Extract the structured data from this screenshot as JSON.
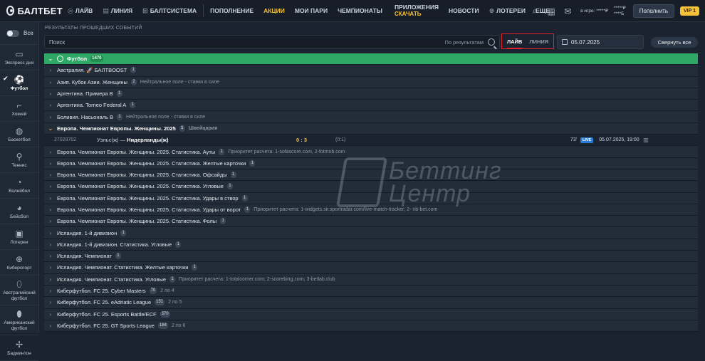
{
  "header": {
    "logo": "БАЛТБЕТ",
    "nav": [
      {
        "label": "ЛАЙВ",
        "icon": "live-icon"
      },
      {
        "label": "ЛИНИЯ",
        "icon": "line-icon"
      },
      {
        "label": "БАЛТСИСТЕМА",
        "icon": "system-icon"
      }
    ],
    "nav2": [
      "ПОПОЛНЕНИЕ",
      "АКЦИИ",
      "МОИ ПАРИ",
      "ЧЕМПИОНАТЫ"
    ],
    "apps": {
      "label": "ПРИЛОЖЕНИЯ",
      "sub": "СКАЧАТЬ"
    },
    "nav3": [
      "НОВОСТИ",
      "ЛОТЕРЕИ",
      "ЕЩЕ..."
    ],
    "balance": {
      "line1": "в игре: *****₽",
      "line2": "*****₽",
      "line3": "*****₽",
      "line4": "****Б"
    },
    "deposit_label": "Пополнить",
    "vip_label": "VIP 1"
  },
  "sidebar": {
    "toggle_label": "Все",
    "sports": [
      {
        "label": "Экспресс дня",
        "icon": "express-icon"
      },
      {
        "label": "Футбол",
        "icon": "football-icon"
      },
      {
        "label": "Хоккей",
        "icon": "hockey-icon"
      },
      {
        "label": "Баскетбол",
        "icon": "basketball-icon"
      },
      {
        "label": "Теннис",
        "icon": "tennis-icon"
      },
      {
        "label": "Волейбол",
        "icon": "volleyball-icon"
      },
      {
        "label": "Бейсбол",
        "icon": "baseball-icon"
      },
      {
        "label": "Лотереи",
        "icon": "lottery-icon"
      },
      {
        "label": "Киберспорт",
        "icon": "esports-icon"
      },
      {
        "label": "Австралийский футбол",
        "icon": "aussie-football-icon"
      },
      {
        "label": "Американский футбол",
        "icon": "american-football-icon"
      },
      {
        "label": "Бадминтон",
        "icon": "badminton-icon"
      }
    ]
  },
  "main": {
    "section_title": "РЕЗУЛЬТАТЫ ПРОШЕДШИХ СОБЫТИЙ",
    "search_placeholder": "Поиск",
    "search_option": "По результатам",
    "mode_live": "ЛАЙВ",
    "mode_line": "ЛИНИЯ",
    "date": "05.07.2025",
    "collapse_label": "Свернуть все",
    "sport_header": {
      "name": "Футбол",
      "count": "1470"
    },
    "rows": [
      {
        "name": "Австралия. 🚀 БАЛТBOOST",
        "count": "1",
        "note": ""
      },
      {
        "name": "Азия. Кубок Азии. Женщины",
        "count": "2",
        "note": "Нейтральное поле - ставки в силе"
      },
      {
        "name": "Аргентина. Примера В",
        "count": "1",
        "note": ""
      },
      {
        "name": "Аргентина. Torneo Federal A",
        "count": "1",
        "note": ""
      },
      {
        "name": "Боливия. Насьональ В",
        "count": "1",
        "note": "Нейтральное поле - ставки в силе"
      }
    ],
    "expanded": {
      "name": "Европа. Чемпионат Европы. Женщины. 2025",
      "count": "1",
      "note": "Швейцария"
    },
    "match": {
      "id": "27029702",
      "home": "Уэльс(ж)",
      "away": "Нидерланды(ж)",
      "score": "0 : 3",
      "half": "(0:1)",
      "minute": "73'",
      "live": "LIVE",
      "datetime": "05.07.2025, 19:00"
    },
    "rows2": [
      {
        "name": "Европа. Чемпионат Европы. Женщины. 2025. Статистика. Ауты",
        "count": "1",
        "note": "Приоритет расчета: 1-sofascore.com, 2-fotmob.com"
      },
      {
        "name": "Европа. Чемпионат Европы. Женщины. 2025. Статистика. Желтые карточки",
        "count": "1",
        "note": ""
      },
      {
        "name": "Европа. Чемпионат Европы. Женщины. 2025. Статистика. Офсайды",
        "count": "1",
        "note": ""
      },
      {
        "name": "Европа. Чемпионат Европы. Женщины. 2025. Статистика. Угловые",
        "count": "1",
        "note": ""
      },
      {
        "name": "Европа. Чемпионат Европы. Женщины. 2025. Статистика. Удары в створ",
        "count": "1",
        "note": ""
      },
      {
        "name": "Европа. Чемпионат Европы. Женщины. 2025. Статистика. Удары от ворот",
        "count": "1",
        "note": "Приоритет расчета: 1-widgets.sir.sportradar.com/live-match-tracker; 2- nb-bet.com"
      },
      {
        "name": "Европа. Чемпионат Европы. Женщины. 2025. Статистика. Фолы",
        "count": "1",
        "note": ""
      },
      {
        "name": "Исландия. 1-й дивизион",
        "count": "1",
        "note": ""
      },
      {
        "name": "Исландия. 1-й дивизион. Статистика. Угловые",
        "count": "1",
        "note": ""
      },
      {
        "name": "Исландия. Чемпионат",
        "count": "1",
        "note": ""
      },
      {
        "name": "Исландия. Чемпионат. Статистика. Желтые карточки",
        "count": "1",
        "note": ""
      },
      {
        "name": "Исландия. Чемпионат. Статистика. Угловые",
        "count": "1",
        "note": "Приоритет расчета: 1-totalcorner.com; 2-scorebing.com; 3-betlab.club"
      },
      {
        "name": "Киберфутбол. FC 25. Cyber Masters",
        "count": "70",
        "note": "2 по 4"
      },
      {
        "name": "Киберфутбол. FC 25. eAdriatic League",
        "count": "151",
        "note": "2 по 5"
      },
      {
        "name": "Киберфутбол. FC 25. Esports Battle/ECF",
        "count": "370",
        "note": ""
      },
      {
        "name": "Киберфутбол. FC 25. GT Sports League",
        "count": "184",
        "note": "2 по 6"
      }
    ],
    "watermark": {
      "line1": "Беттинг",
      "line2": "Центр"
    }
  }
}
